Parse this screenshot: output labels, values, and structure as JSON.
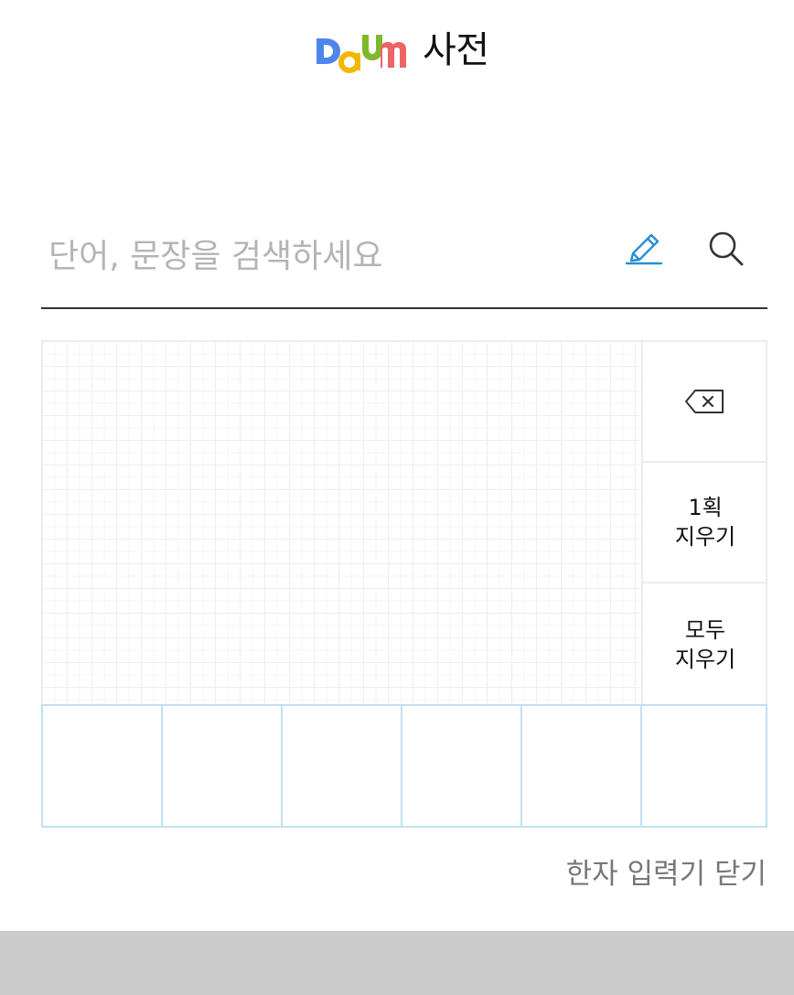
{
  "header": {
    "logo_text": "Daum",
    "service_name": "사전"
  },
  "search": {
    "placeholder": "단어, 문장을 검색하세요",
    "value": "",
    "pen_icon": "pen-icon",
    "search_icon": "search-icon"
  },
  "handwriting": {
    "backspace_icon": "backspace-icon",
    "undo_line1": "1획",
    "undo_line2": "지우기",
    "clear_line1": "모두",
    "clear_line2": "지우기",
    "candidates": [
      "",
      "",
      "",
      "",
      "",
      ""
    ]
  },
  "close_hanja_label": "한자 입력기 닫기",
  "colors": {
    "accent_blue": "#2a8fd4",
    "candidate_border": "#bfe0f2",
    "logo_D": "#4f86ec",
    "logo_a": "#f2b705",
    "logo_u": "#7fb82a",
    "logo_m": "#ec6464",
    "footer_band": "#cccccc"
  }
}
